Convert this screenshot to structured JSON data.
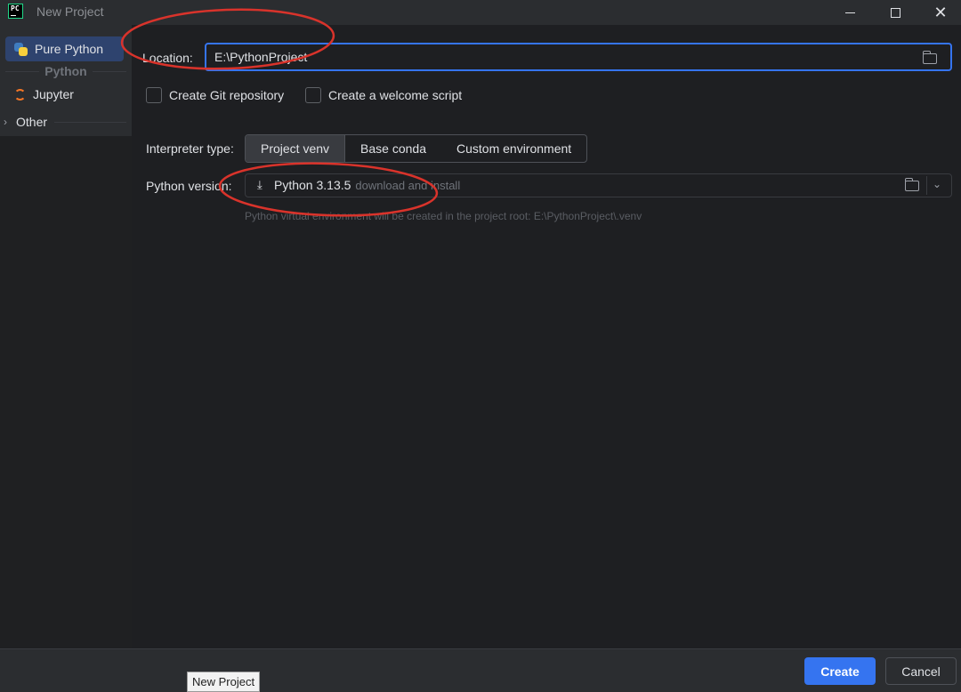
{
  "window": {
    "app_icon_text": "PC",
    "title": "New Project",
    "close_glyph": "✕"
  },
  "sidebar": {
    "items": [
      {
        "label": "Pure Python",
        "icon": "python-icon",
        "selected": true
      },
      {
        "label": "Jupyter",
        "icon": "jupyter-icon",
        "selected": false
      }
    ],
    "group_label": "Python",
    "other_label": "Other",
    "other_chevron": "›"
  },
  "form": {
    "location_label": "Location:",
    "location_value": "E:\\PythonProject",
    "create_git_label": "Create Git repository",
    "welcome_script_label": "Create a welcome script",
    "interpreter_label": "Interpreter type:",
    "interpreter_options": [
      "Project venv",
      "Base conda",
      "Custom environment"
    ],
    "interpreter_selected": "Project venv",
    "python_version_label": "Python version:",
    "python_version_value": "Python 3.13.5",
    "python_version_note": "download and install",
    "venv_hint": "Python virtual environment will be created in the project root: E:\\PythonProject\\.venv"
  },
  "footer": {
    "create_label": "Create",
    "cancel_label": "Cancel"
  },
  "tooltip": {
    "text": "New Project"
  },
  "colors": {
    "accent": "#3574f0",
    "annotation": "#d9332b"
  }
}
